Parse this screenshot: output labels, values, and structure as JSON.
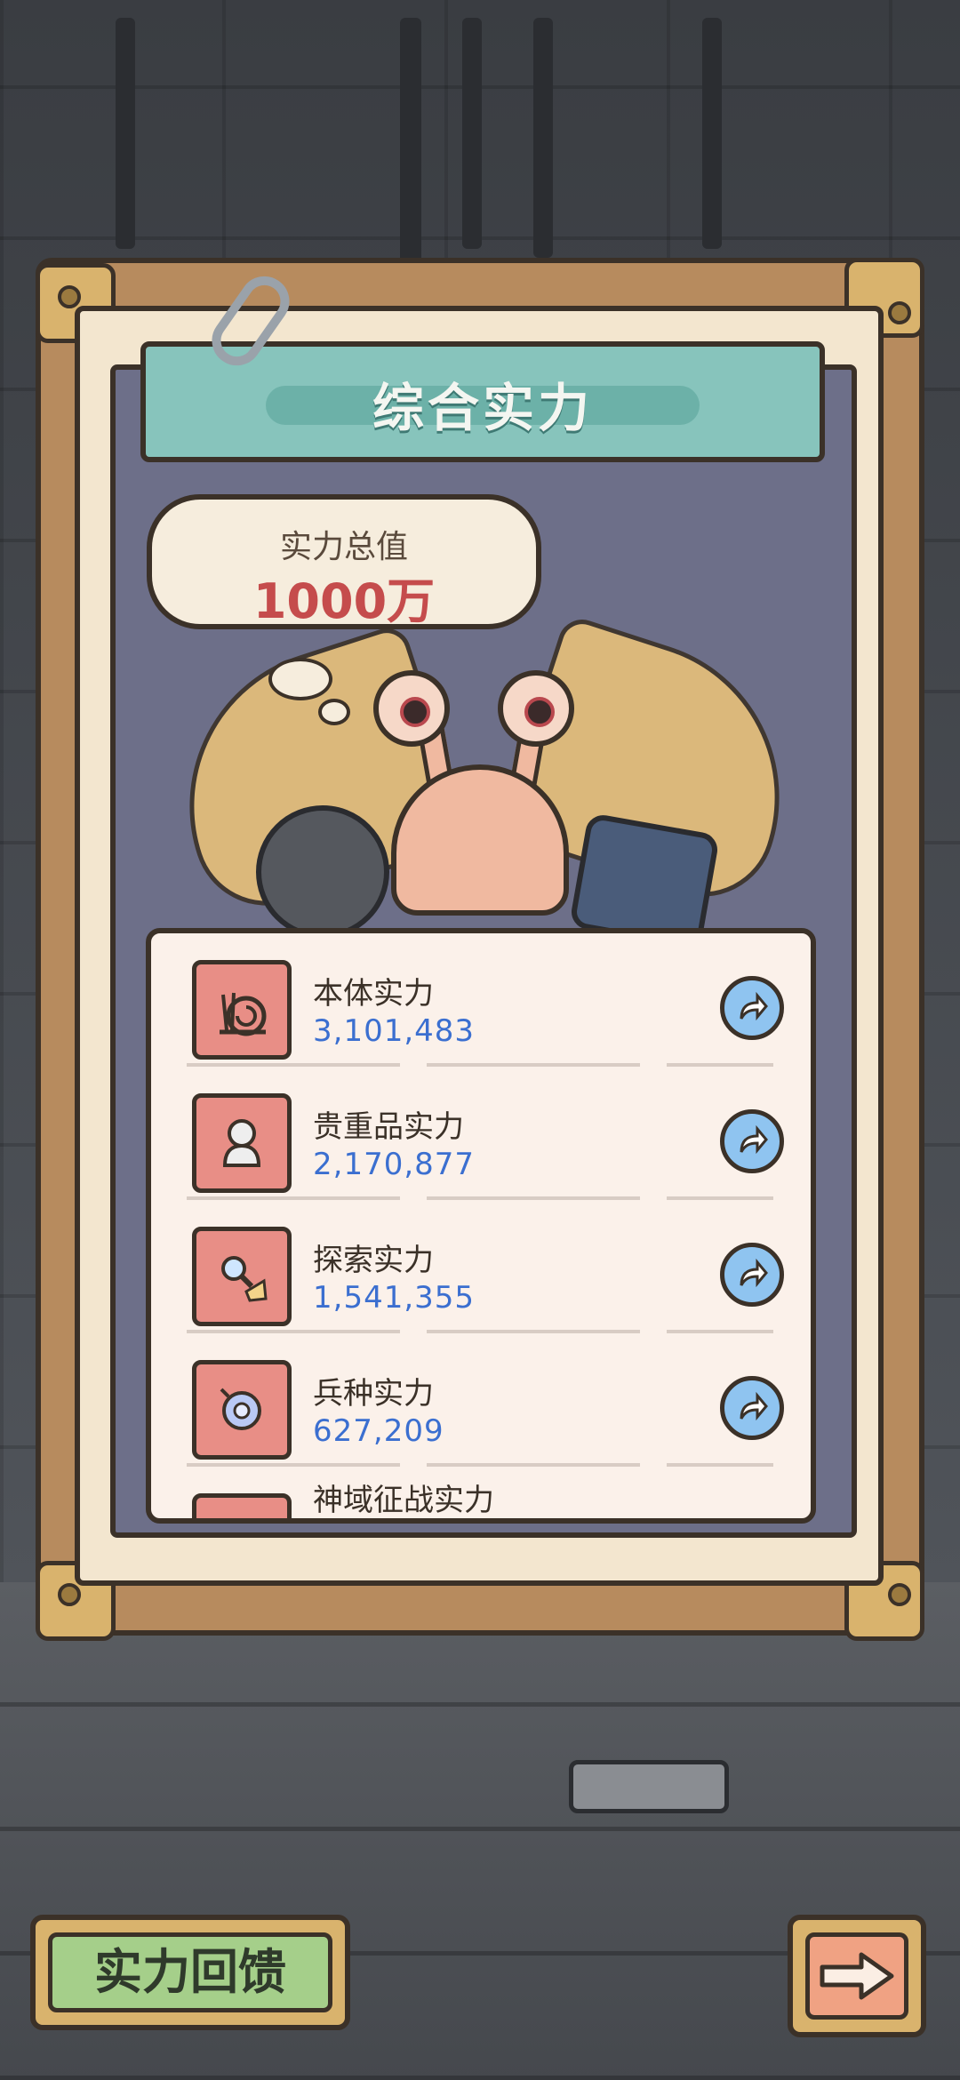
{
  "panel": {
    "title": "综合实力",
    "total_label": "实力总值",
    "total_value": "1000万"
  },
  "power_list": [
    {
      "label": "本体实力",
      "value": "3,101,483",
      "icon": "snail-icon"
    },
    {
      "label": "贵重品实力",
      "value": "2,170,877",
      "icon": "statue-bust-icon"
    },
    {
      "label": "探索实力",
      "value": "1,541,355",
      "icon": "magnifier-broom-icon"
    },
    {
      "label": "兵种实力",
      "value": "627,209",
      "icon": "pacifier-icon"
    },
    {
      "label": "神域征战实力",
      "value": "",
      "icon": "partial-icon"
    }
  ],
  "buttons": {
    "feedback_label": "实力回馈",
    "next_icon": "arrow-right-icon",
    "share_icon": "share-arrow-icon"
  }
}
